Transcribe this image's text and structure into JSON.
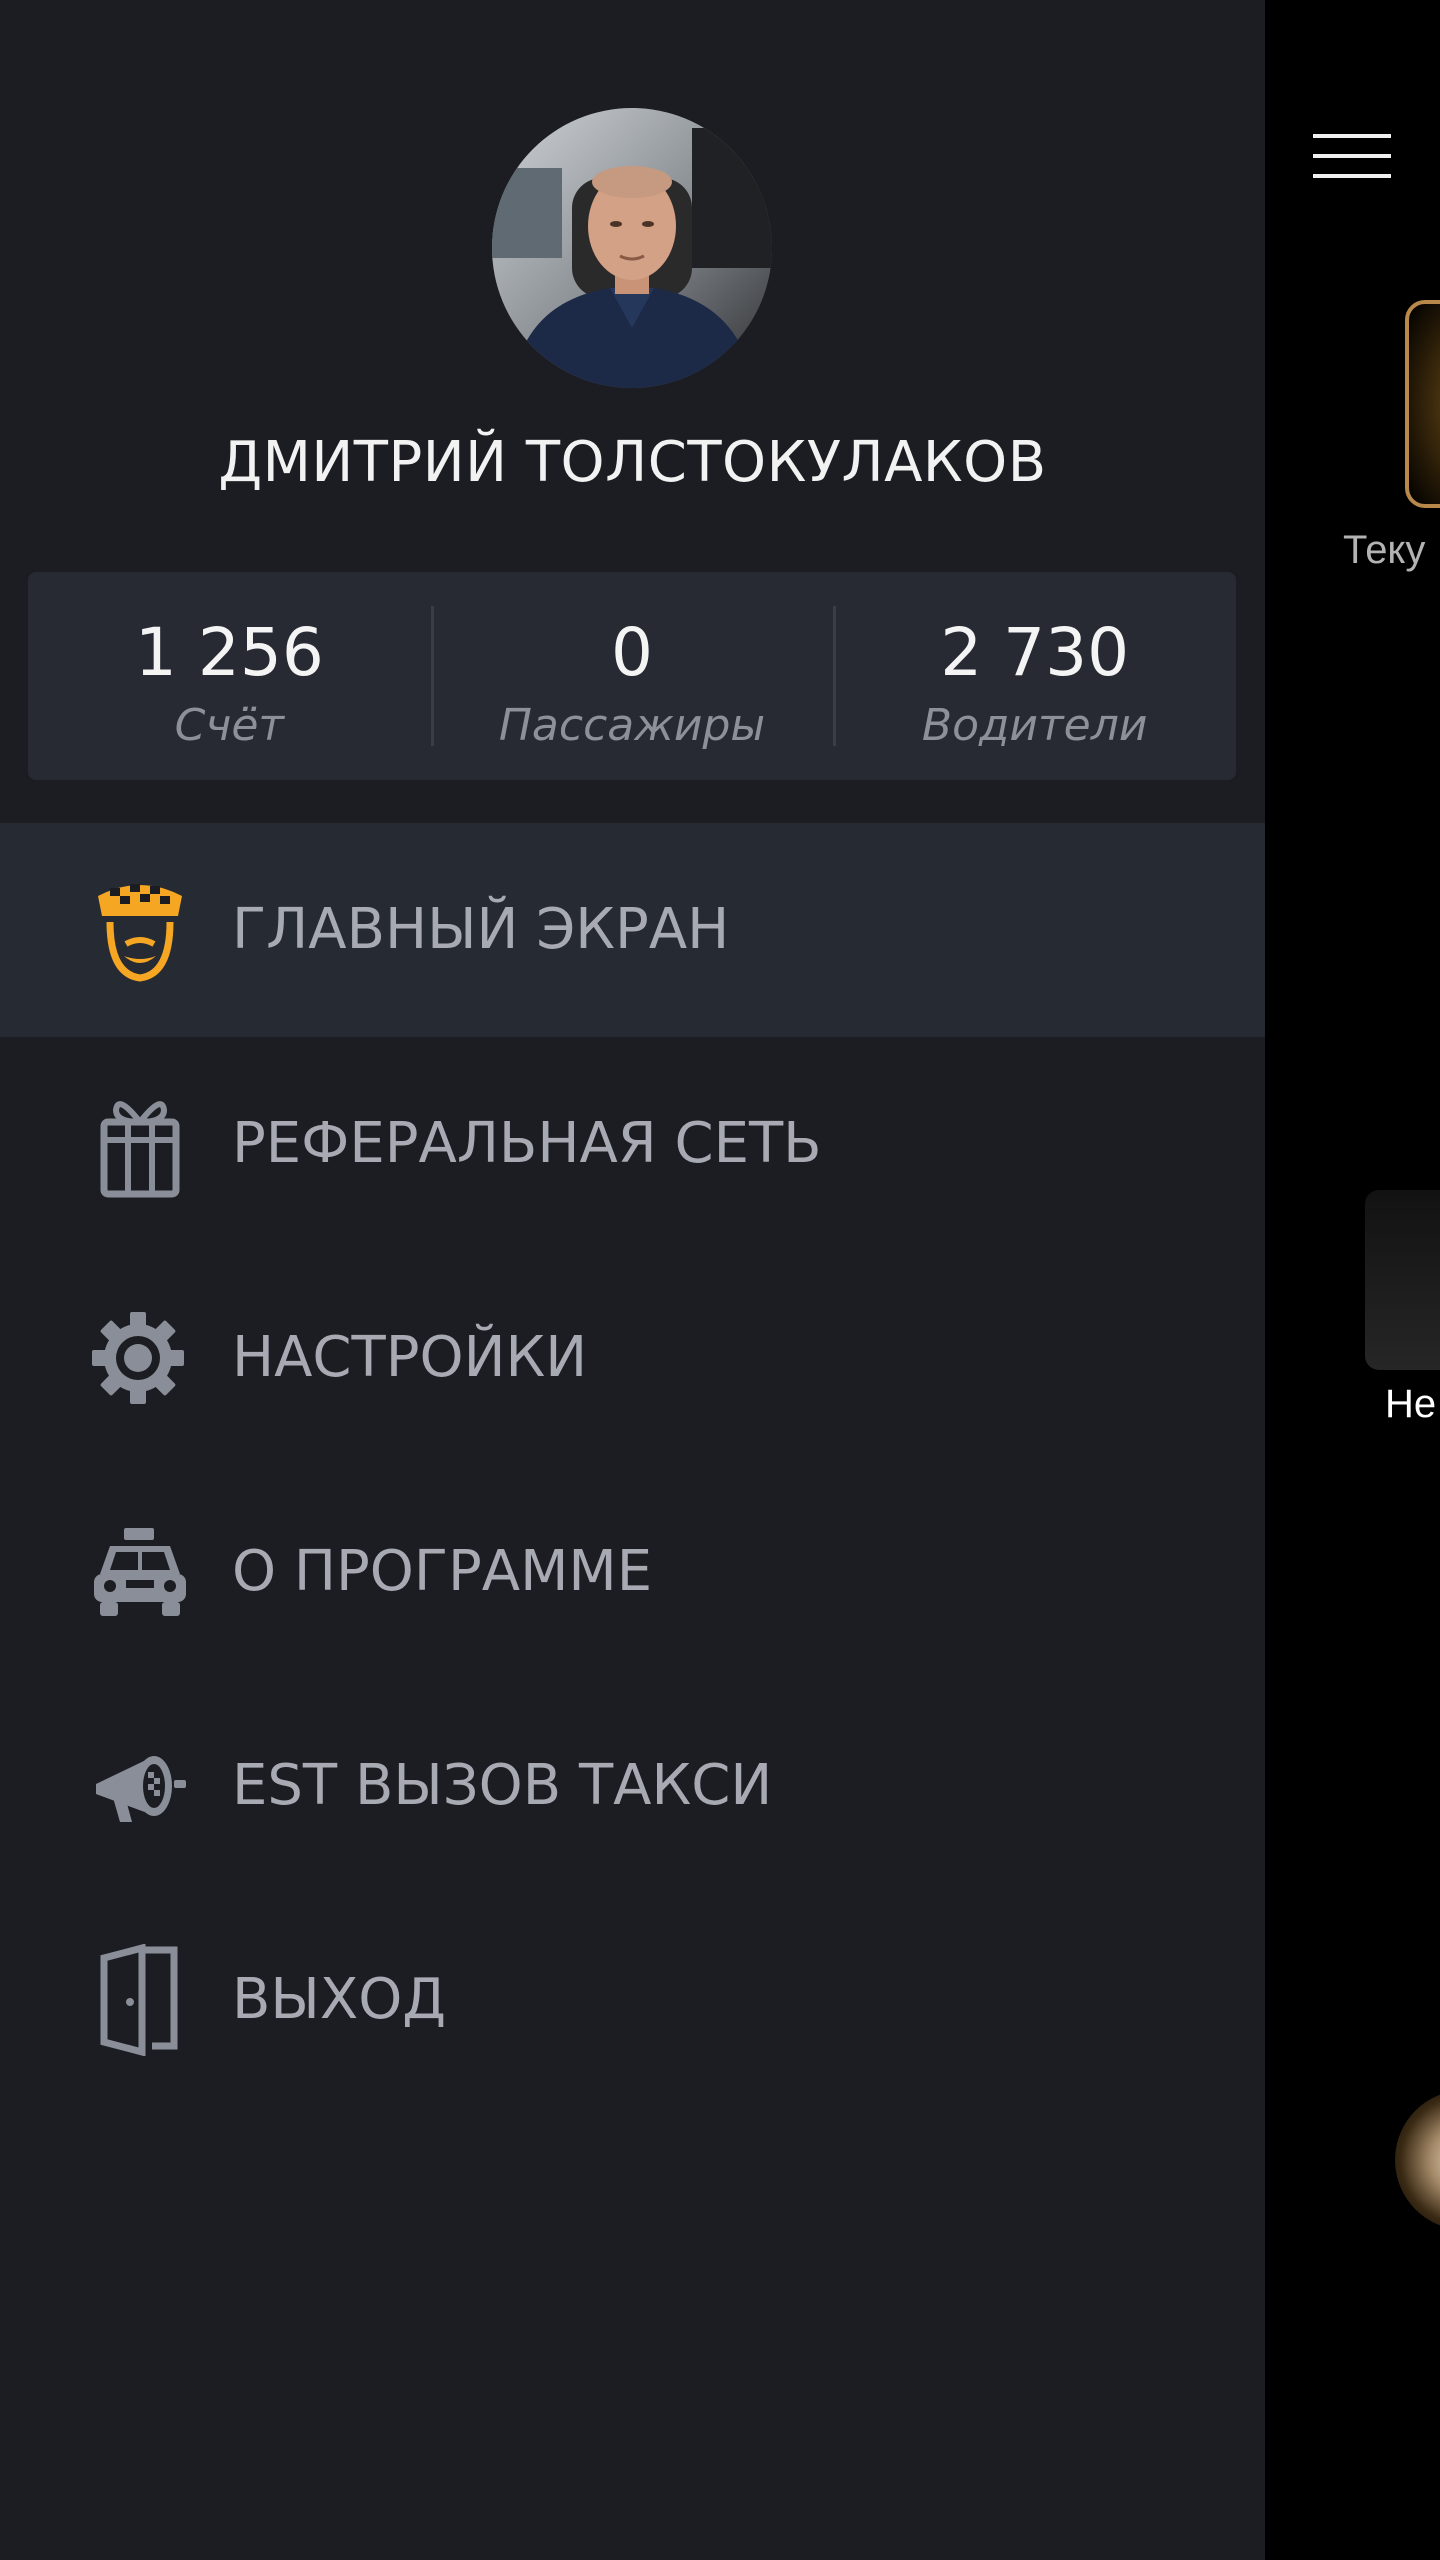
{
  "profile": {
    "name": "ДМИТРИЙ ТОЛСТОКУЛАКОВ"
  },
  "stats": [
    {
      "value": "1 256",
      "label": "Счёт"
    },
    {
      "value": "0",
      "label": "Пассажиры"
    },
    {
      "value": "2 730",
      "label": "Водители"
    }
  ],
  "menu": [
    {
      "label": "ГЛАВНЫЙ ЭКРАН",
      "icon": "driver-cap-icon",
      "active": true
    },
    {
      "label": "РЕФЕРАЛЬНАЯ СЕТЬ",
      "icon": "gift-icon",
      "active": false
    },
    {
      "label": "НАСТРОЙКИ",
      "icon": "gear-icon",
      "active": false
    },
    {
      "label": "О ПРОГРАММЕ",
      "icon": "taxi-car-icon",
      "active": false
    },
    {
      "label": "EST ВЫЗОВ ТАКСИ",
      "icon": "megaphone-icon",
      "active": false
    },
    {
      "label": "ВЫХОД",
      "icon": "exit-door-icon",
      "active": false
    }
  ],
  "background_screen": {
    "peek_text_1": "Теку",
    "peek_text_2": "Не"
  },
  "colors": {
    "drawer_bg": "#1c1d22",
    "stats_bg": "#272a33",
    "active_item_bg": "#262a33",
    "accent": "#f5a623",
    "menu_text": "#a7aab3",
    "icon_gray": "#8a8e98"
  }
}
